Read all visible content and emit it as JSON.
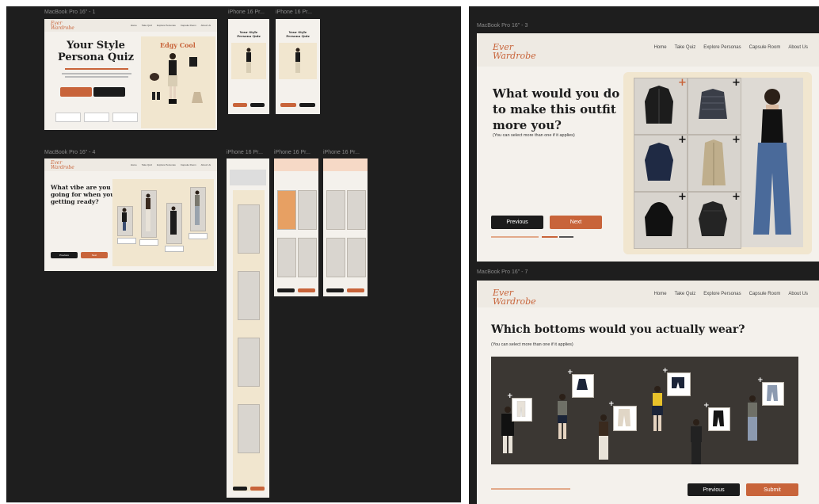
{
  "labels": {
    "f1": "MacBook Pro 16\" - 1",
    "f2": "iPhone 16 Pr...",
    "f3": "iPhone 16 Pr...",
    "f4": "MacBook Pro 16\" - 4",
    "f5": "iPhone 16 Pr...",
    "f6": "iPhone 16 Pr...",
    "f7": "iPhone 16 Pr...",
    "f8": "MacBook Pro 16\" - 3",
    "f9": "MacBook Pro 16\" - 7"
  },
  "brand": {
    "logo_line1": "Ever",
    "logo_line2": "Wardrobe"
  },
  "nav": [
    "Home",
    "Take Quiz",
    "Explore Personas",
    "Capsule Room",
    "About Us"
  ],
  "frame1": {
    "title_line1": "Your Style",
    "title_line2": "Persona Quiz",
    "persona_title": "Edgy Cool"
  },
  "frame4": {
    "question_line1": "What vibe are you",
    "question_line2": "going for when you",
    "question_line3": "getting ready?",
    "previous": "Previous",
    "next": "Next"
  },
  "frame3": {
    "question_line1": "What would you do",
    "question_line2": "to make this outfit",
    "question_line3": "more you?",
    "hint": "(You can select more than one if it applies)",
    "previous": "Previous",
    "next": "Next"
  },
  "frame7": {
    "question": "Which bottoms would you actually wear?",
    "hint": "(You can select more than one if it applies)",
    "previous": "Previous",
    "submit": "Submit"
  },
  "colors": {
    "accent": "#c8643a",
    "dark": "#1b1b1b",
    "canvas": "#1e1e1e",
    "cream": "#f1e6cf"
  }
}
